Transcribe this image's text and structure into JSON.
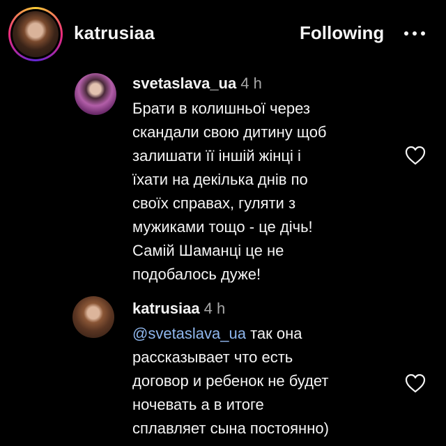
{
  "header": {
    "username": "katrusiaa",
    "follow_label": "Following",
    "more_icon": "more-horizontal-icon"
  },
  "comments": [
    {
      "username": "svetaslava_ua",
      "time": "4 h",
      "text": "Брати в колишньої через\nскандали свою дитину щоб\nзалишати її іншій жінці і\nїхати на декілька днів по\nсвоїх справах, гуляти з\nмужиками тощо - це дічь!\nСамій Шаманці це не\nподобалось дуже!",
      "like_icon": "heart-outline-icon"
    },
    {
      "username": "katrusiaa",
      "time": "4 h",
      "mention": "@svetaslava_ua",
      "text": " так она\nрассказывает что есть\nдоговор и ребенок не будет\nночевать а в итоге\nсплавляет сына постоянно)",
      "like_icon": "heart-outline-icon"
    }
  ],
  "colors": {
    "background": "#000000",
    "text": "#f5f5f5",
    "secondary_text": "#a8a8a8",
    "mention": "#8fb7ee"
  }
}
